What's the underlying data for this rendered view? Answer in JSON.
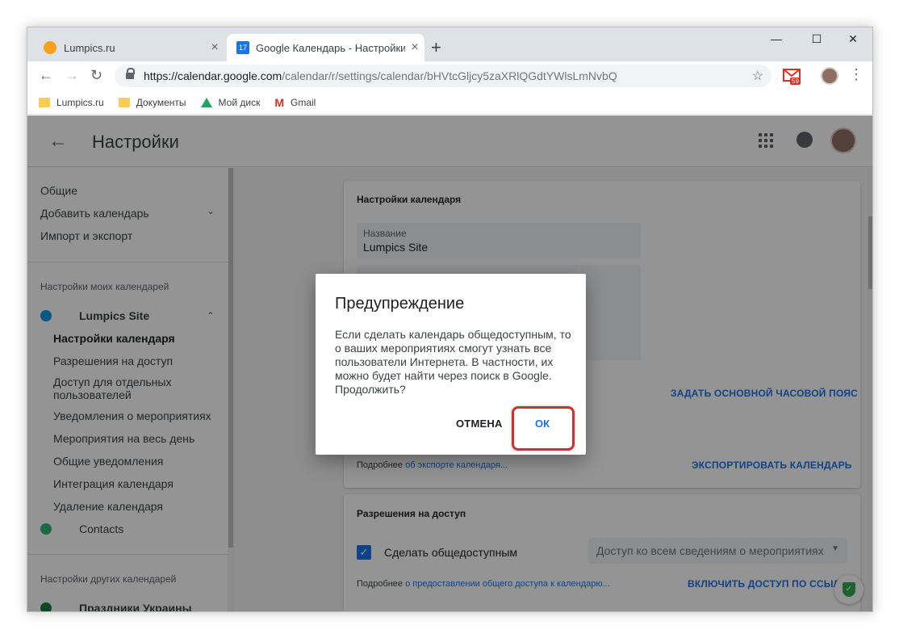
{
  "browser": {
    "tabs": [
      {
        "title": "Lumpics.ru",
        "active": false
      },
      {
        "title": "Google Календарь - Настройки",
        "active": true
      }
    ],
    "tab_close_glyph": "×",
    "new_tab_glyph": "+",
    "window_controls": {
      "minimize": "—",
      "maximize": "☐",
      "close": "✕"
    },
    "nav": {
      "back": "←",
      "forward": "→",
      "reload": "↻"
    },
    "url": {
      "protocol_host": "https://calendar.google.com",
      "path": "/calendar/r/settings/calendar/bHVtcGljcy5zaXRlQGdtYWlsLmNvbQ"
    },
    "star_glyph": "☆",
    "gmail_badge": "59",
    "menu_glyph": "⋮",
    "favicon_cal_day": "17",
    "bookmarks": [
      {
        "label": "Lumpics.ru",
        "icon": "folder-icon"
      },
      {
        "label": "Документы",
        "icon": "folder-icon"
      },
      {
        "label": "Мой диск",
        "icon": "drive-icon"
      },
      {
        "label": "Gmail",
        "icon": "gmail-icon"
      }
    ],
    "gmail_glyph": "M"
  },
  "header": {
    "back_glyph": "←",
    "title": "Настройки"
  },
  "sidebar": {
    "general": "Общие",
    "add_calendar": "Добавить календарь",
    "import_export": "Импорт и экспорт",
    "my_calendars_header": "Настройки моих календарей",
    "calendar_name": "Lumpics Site",
    "sub_items": [
      "Настройки календаря",
      "Разрешения на доступ",
      "Доступ для отдельных",
      "пользователей",
      "Уведомления о мероприятиях",
      "Мероприятия на весь день",
      "Общие уведомления",
      "Интеграция календаря",
      "Удаление календаря"
    ],
    "contacts": "Contacts",
    "other_calendars_header": "Настройки других календарей",
    "holidays": "Праздники Украины",
    "chevron_down": "⌄",
    "chevron_up": "⌃",
    "colors": {
      "lumpics": "#039be5",
      "contacts": "#33b679",
      "holidays": "#0b8043"
    }
  },
  "content": {
    "card1_title": "Настройки календаря",
    "name_label": "Название",
    "name_value": "Lumpics Site",
    "timezone_link": "ЗАДАТЬ ОСНОВНОЙ ЧАСОВОЙ ПОЯС",
    "export_more": "Подробнее",
    "export_more_link": "об экспорте календаря...",
    "export_button": "ЭКСПОРТИРОВАТЬ КАЛЕНДАРЬ",
    "card2_title": "Разрешения на доступ",
    "checkbox_mark": "✓",
    "make_public_label": "Сделать общедоступным",
    "access_select_value": "Доступ ко всем сведениям о мероприятиях",
    "access_select_arrow": "▼",
    "share_more": "Подробнее",
    "share_more_link": "о предоставлении общего доступа к календарю...",
    "share_link_button": "ВКЛЮЧИТЬ ДОСТУП ПО ССЫЛКЕ",
    "shield_glyph": "✓"
  },
  "dialog": {
    "title": "Предупреждение",
    "body": "Если сделать календарь общедоступным, то о ваших мероприятиях смогут узнать все пользователи Интернета. В частности, их можно будет найти через поиск в Google. Продолжить?",
    "cancel_label": "ОТМЕНА",
    "ok_label": "ОК"
  },
  "colors": {
    "accent": "#1a73e8",
    "highlight": "#d32f2f"
  }
}
